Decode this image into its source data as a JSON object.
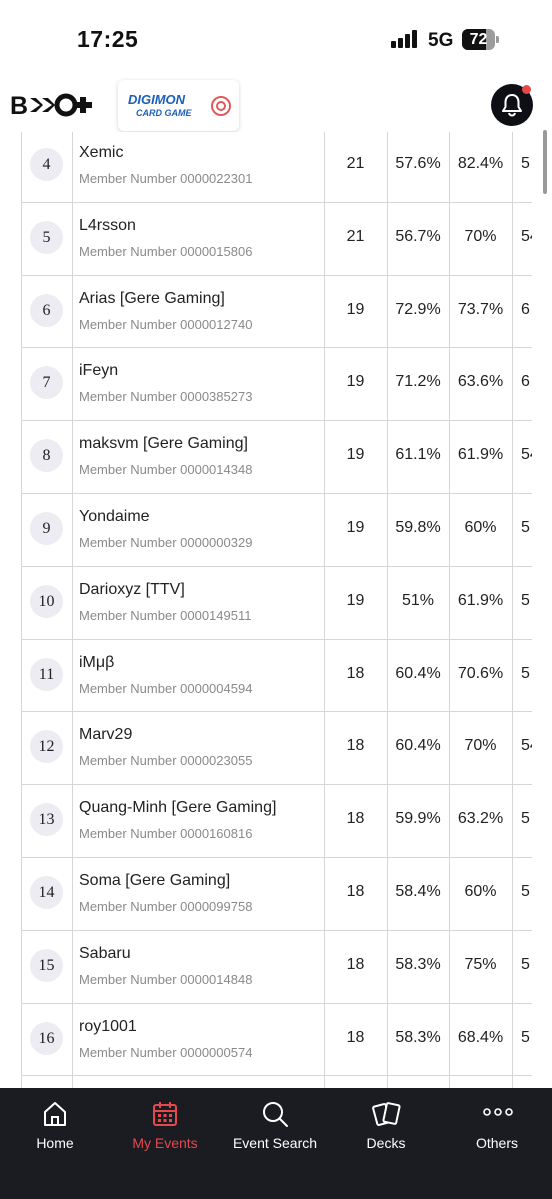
{
  "status": {
    "time": "17:25",
    "network": "5G",
    "battery": "72",
    "battery_level": 0.72
  },
  "header": {
    "logo_text": "BCG+",
    "game_logo_line1": "DIGIMON",
    "game_logo_line2": "CARD GAME"
  },
  "standings": [
    {
      "rank": "4",
      "name": "Xemic",
      "member": "Member Number 0000022301",
      "points": "21",
      "omw": "57.6%",
      "gw": "82.4%",
      "oow": "5"
    },
    {
      "rank": "5",
      "name": "L4rsson",
      "member": "Member Number 0000015806",
      "points": "21",
      "omw": "56.7%",
      "gw": "70%",
      "oow": "54"
    },
    {
      "rank": "6",
      "name": "Arias [Gere Gaming]",
      "member": "Member Number 0000012740",
      "points": "19",
      "omw": "72.9%",
      "gw": "73.7%",
      "oow": "6"
    },
    {
      "rank": "7",
      "name": "iFeyn",
      "member": "Member Number 0000385273",
      "points": "19",
      "omw": "71.2%",
      "gw": "63.6%",
      "oow": "6"
    },
    {
      "rank": "8",
      "name": "maksvm [Gere Gaming]",
      "member": "Member Number 0000014348",
      "points": "19",
      "omw": "61.1%",
      "gw": "61.9%",
      "oow": "54"
    },
    {
      "rank": "9",
      "name": "Yondaime",
      "member": "Member Number 0000000329",
      "points": "19",
      "omw": "59.8%",
      "gw": "60%",
      "oow": "5"
    },
    {
      "rank": "10",
      "name": "Darioxyz [TTV]",
      "member": "Member Number 0000149511",
      "points": "19",
      "omw": "51%",
      "gw": "61.9%",
      "oow": "5"
    },
    {
      "rank": "11",
      "name": "iMμβ",
      "member": "Member Number 0000004594",
      "points": "18",
      "omw": "60.4%",
      "gw": "70.6%",
      "oow": "5"
    },
    {
      "rank": "12",
      "name": "Marv29",
      "member": "Member Number 0000023055",
      "points": "18",
      "omw": "60.4%",
      "gw": "70%",
      "oow": "54"
    },
    {
      "rank": "13",
      "name": "Quang-Minh [Gere Gaming]",
      "member": "Member Number 0000160816",
      "points": "18",
      "omw": "59.9%",
      "gw": "63.2%",
      "oow": "5"
    },
    {
      "rank": "14",
      "name": "Soma [Gere Gaming]",
      "member": "Member Number 0000099758",
      "points": "18",
      "omw": "58.4%",
      "gw": "60%",
      "oow": "5"
    },
    {
      "rank": "15",
      "name": "Sabaru",
      "member": "Member Number 0000014848",
      "points": "18",
      "omw": "58.3%",
      "gw": "75%",
      "oow": "5"
    },
    {
      "rank": "16",
      "name": "roy1001",
      "member": "Member Number 0000000574",
      "points": "18",
      "omw": "58.3%",
      "gw": "68.4%",
      "oow": "5"
    }
  ],
  "nav": {
    "home": "Home",
    "my_events": "My Events",
    "event_search": "Event Search",
    "decks": "Decks",
    "others": "Others",
    "active": "my_events",
    "active_color": "#e5484d"
  }
}
